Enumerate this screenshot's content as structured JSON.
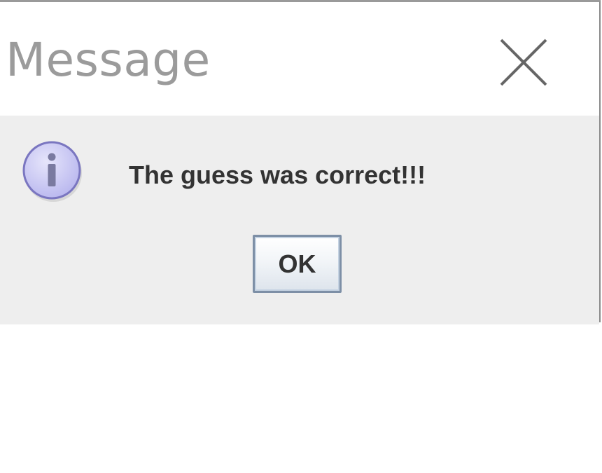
{
  "dialog": {
    "title": "Message",
    "close_icon": "close-icon",
    "message_icon": "info-icon",
    "message": "The guess was correct!!!",
    "ok_label": "OK"
  },
  "colors": {
    "title_text": "#9b9b9b",
    "content_background": "#eeeeee",
    "message_text": "#333333",
    "button_border": "#7d8fa6",
    "info_icon_fill": "#c9c8f4",
    "info_icon_stroke": "#7a76c0"
  }
}
